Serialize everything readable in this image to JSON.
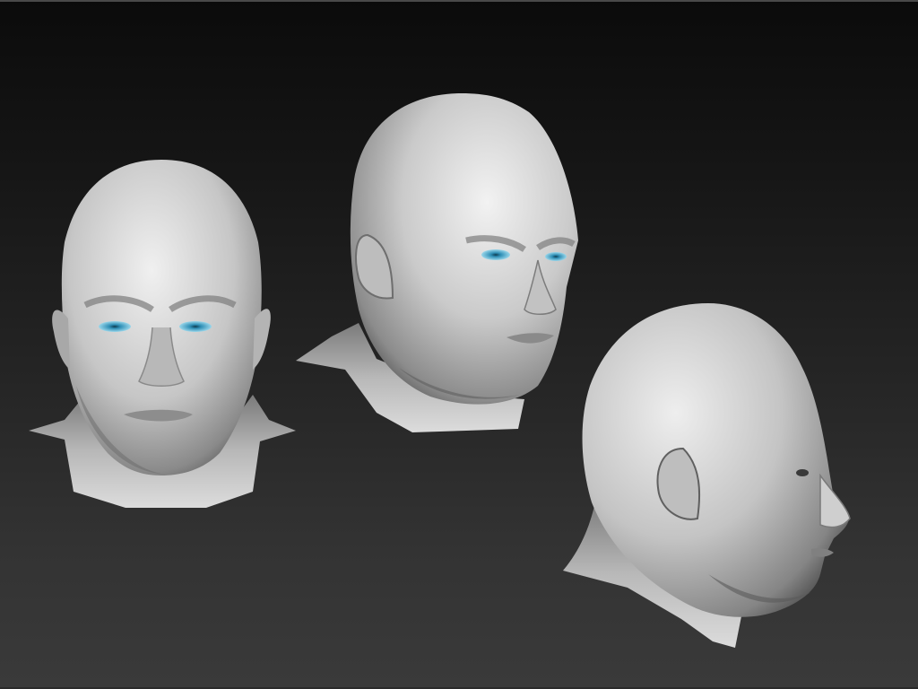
{
  "viewport": {
    "background_top": "#0b0b0b",
    "background_bottom": "#3a3a3a"
  },
  "material": {
    "skin": "#c8c8c8",
    "skin_highlight": "#f2f2f2",
    "skin_shadow": "#4a4a4a",
    "iris": "#2f8fb6"
  },
  "views": [
    {
      "name": "front-view"
    },
    {
      "name": "three-quarter-view"
    },
    {
      "name": "side-profile-view"
    }
  ]
}
